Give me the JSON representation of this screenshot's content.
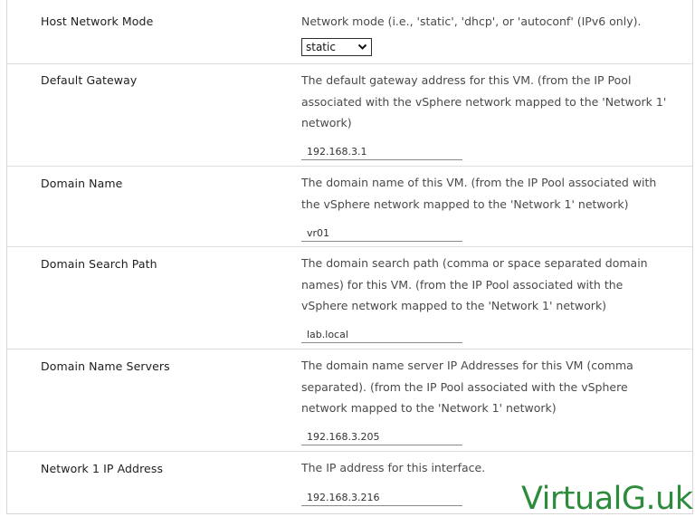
{
  "rows": [
    {
      "label": "Host Network Mode",
      "description": "Network mode (i.e., 'static', 'dhcp', or 'autoconf' (IPv6 only).",
      "control": "select",
      "value": "static"
    },
    {
      "label": "Default Gateway",
      "description": "The default gateway address for this VM. (from the IP Pool associated with the vSphere network mapped to the 'Network 1' network)",
      "control": "text",
      "value": "192.168.3.1"
    },
    {
      "label": "Domain Name",
      "description": "The domain name of this VM. (from the IP Pool associated with the vSphere network mapped to the 'Network 1' network)",
      "control": "text",
      "value": "vr01"
    },
    {
      "label": "Domain Search Path",
      "description": "The domain search path (comma or space separated domain names) for this VM. (from the IP Pool associated with the vSphere network mapped to the 'Network 1' network)",
      "control": "text",
      "value": "lab.local"
    },
    {
      "label": "Domain Name Servers",
      "description": "The domain name server IP Addresses for this VM (comma separated). (from the IP Pool associated with the vSphere network mapped to the 'Network 1' network)",
      "control": "text",
      "value": "192.168.3.205"
    },
    {
      "label": "Network 1 IP Address",
      "description": "The IP address for this interface.",
      "control": "text",
      "value": "192.168.3.216"
    }
  ],
  "watermark": "VirtualG.uk",
  "icons": {
    "select_chevron": "chevron-down-icon"
  },
  "colors": {
    "watermark": "#2d8b3c",
    "label_text": "#1e1e1e",
    "description_text": "#4a4a4a",
    "divider": "#dedede"
  }
}
